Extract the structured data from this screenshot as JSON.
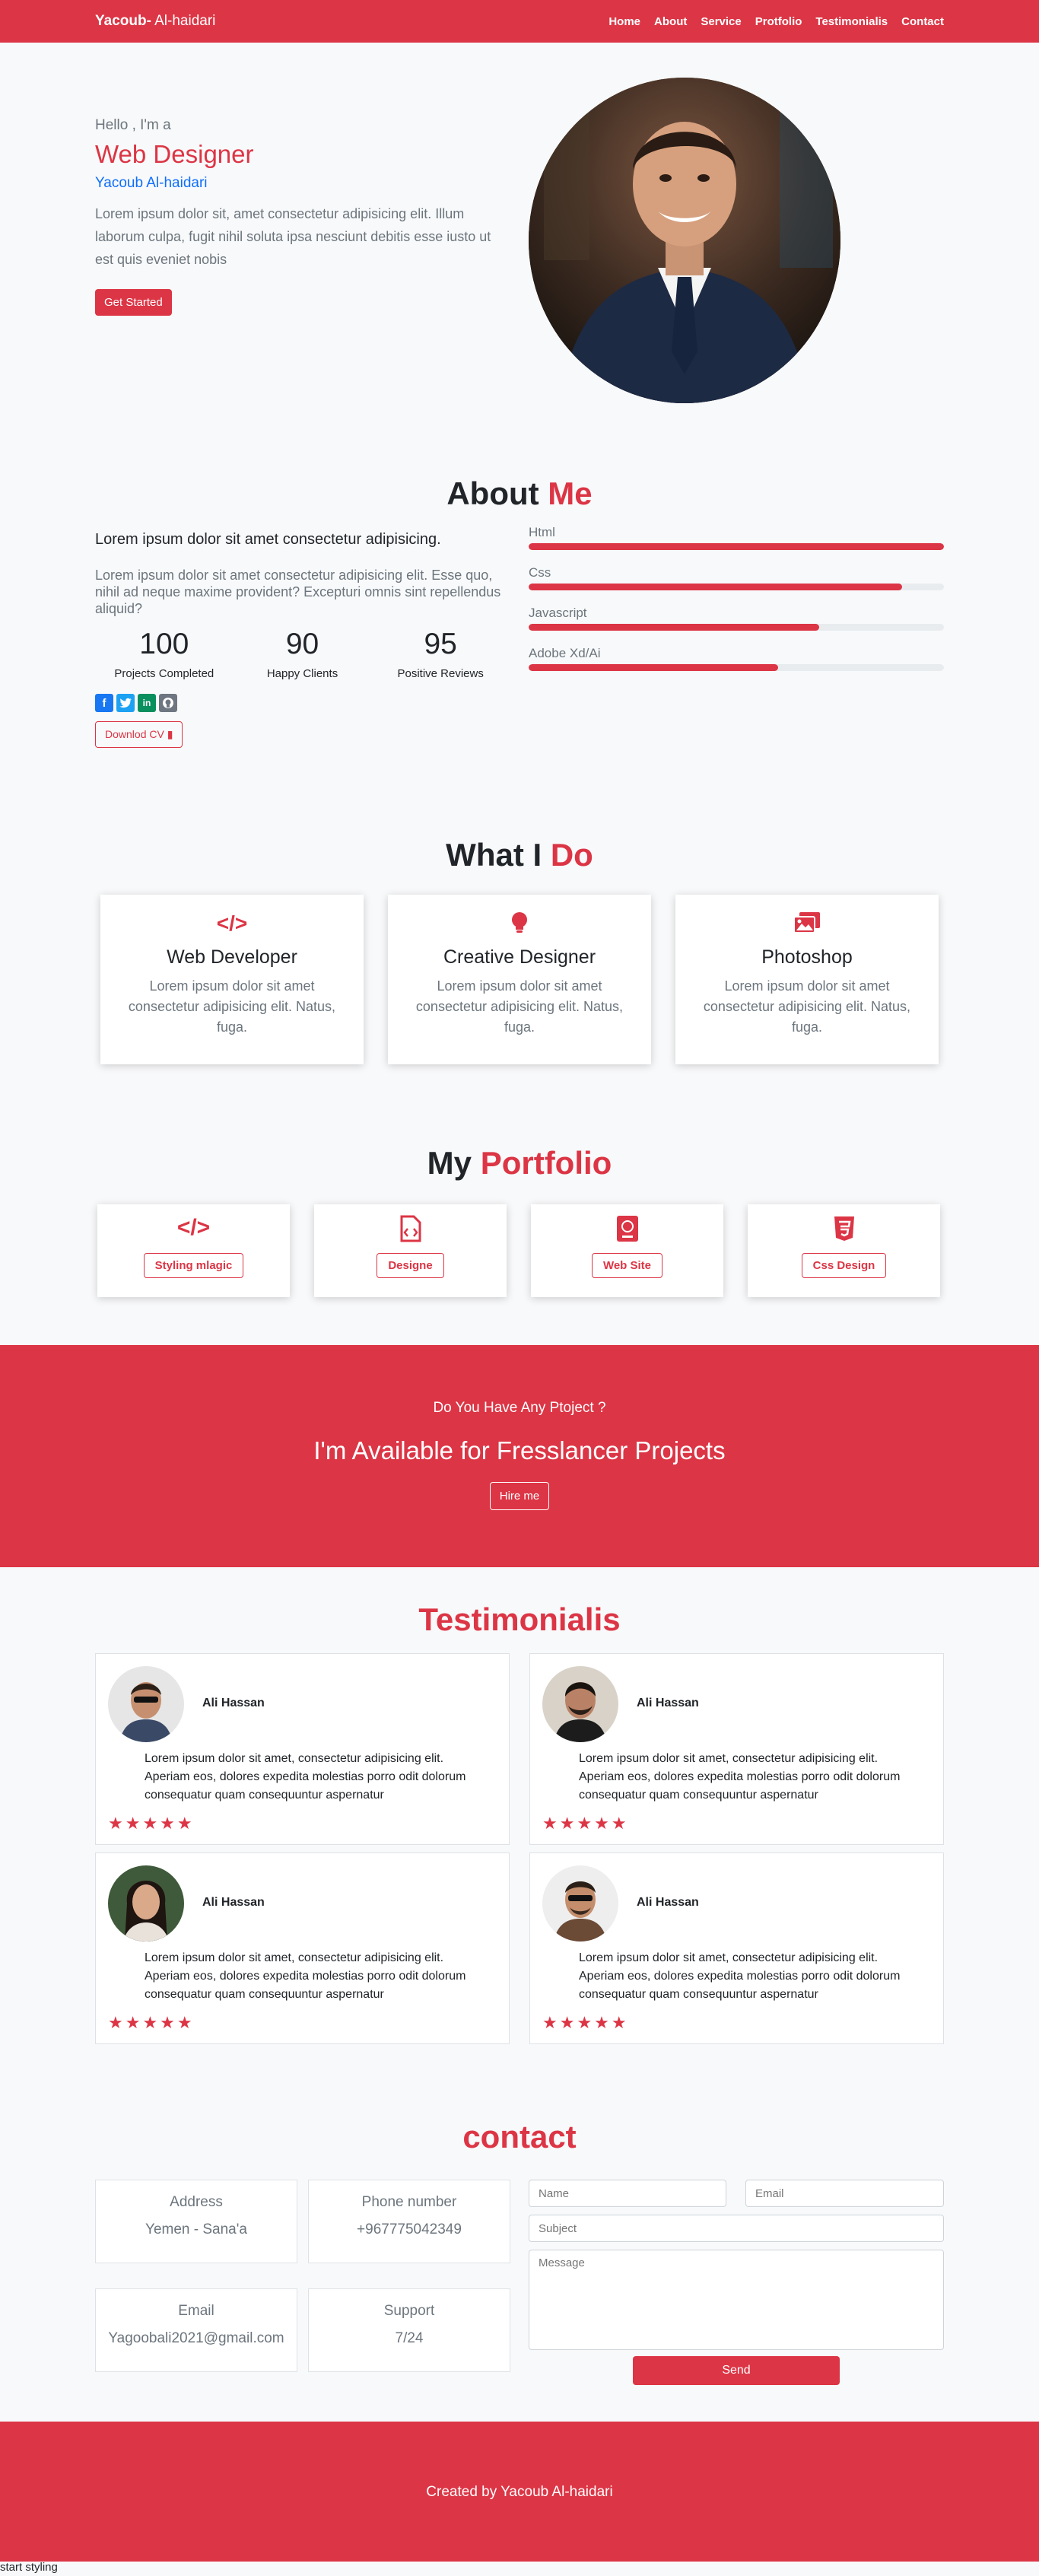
{
  "nav": {
    "brand_bold": "Yacoub-",
    "brand_rest": " Al-haidari",
    "links": [
      "Home",
      "About",
      "Service",
      "Protfolio",
      "Testimonialis",
      "Contact"
    ]
  },
  "hero": {
    "hello": "Hello , I'm a",
    "role": "Web Designer",
    "name": "Yacoub Al-haidari",
    "text": "Lorem ipsum dolor sit, amet consectetur adipisicing elit. Illum laborum culpa, fugit nihil soluta ipsa nesciunt debitis esse iusto ut est quis eveniet nobis",
    "button": "Get Started"
  },
  "about": {
    "title_a": "About ",
    "title_b": "Me",
    "lead": "Lorem ipsum dolor sit amet consectetur adipisicing.",
    "text": "Lorem ipsum dolor sit amet consectetur adipisicing elit. Esse quo, nihil ad neque maxime provident? Excepturi omnis sint repellendus aliquid?",
    "stats": [
      {
        "num": "100",
        "label": "Projects Completed"
      },
      {
        "num": "90",
        "label": "Happy Clients"
      },
      {
        "num": "95",
        "label": "Positive Reviews"
      }
    ],
    "download": "Downlod CV",
    "skills": [
      {
        "label": "Html",
        "level": 1.0
      },
      {
        "label": "Css",
        "level": 0.9
      },
      {
        "label": "Javascript",
        "level": 0.7
      },
      {
        "label": "Adobe Xd/Ai",
        "level": 0.6
      }
    ],
    "colors": {
      "facebook": "#1877f2",
      "twitter": "#1da1f2",
      "linkedin": "#0a8f5f",
      "github": "#6e7681"
    }
  },
  "services": {
    "title_a": "What I ",
    "title_b": "Do",
    "items": [
      {
        "icon": "code-icon",
        "title": "Web Developer",
        "text": "Lorem ipsum dolor sit amet consectetur adipisicing elit. Natus, fuga."
      },
      {
        "icon": "lightbulb-icon",
        "title": "Creative Designer",
        "text": "Lorem ipsum dolor sit amet consectetur adipisicing elit. Natus, fuga."
      },
      {
        "icon": "images-icon",
        "title": "Photoshop",
        "text": "Lorem ipsum dolor sit amet consectetur adipisicing elit. Natus, fuga."
      }
    ]
  },
  "portfolio": {
    "title_a": "My ",
    "title_b": "Portfolio",
    "items": [
      {
        "icon": "code-icon",
        "label": "Styling mlagic"
      },
      {
        "icon": "file-code-icon",
        "label": "Designe"
      },
      {
        "icon": "book-icon",
        "label": "Web Site"
      },
      {
        "icon": "css3-icon",
        "label": "Css Design"
      }
    ]
  },
  "hire": {
    "question": "Do You Have Any Ptoject ?",
    "heading": "I'm Available for Fresslancer Projects",
    "button": "Hire me"
  },
  "testimonials": {
    "title": "Testimonialis",
    "items": [
      {
        "name": "Ali Hassan",
        "text": "Lorem ipsum dolor sit amet, consectetur adipisicing elit. Aperiam eos, dolores expedita molestias porro odit dolorum consequatur quam consequuntur aspernatur",
        "rating": 5
      },
      {
        "name": "Ali Hassan",
        "text": "Lorem ipsum dolor sit amet, consectetur adipisicing elit. Aperiam eos, dolores expedita molestias porro odit dolorum consequatur quam consequuntur aspernatur",
        "rating": 5
      },
      {
        "name": "Ali Hassan",
        "text": "Lorem ipsum dolor sit amet, consectetur adipisicing elit. Aperiam eos, dolores expedita molestias porro odit dolorum consequatur quam consequuntur aspernatur",
        "rating": 5
      },
      {
        "name": "Ali Hassan",
        "text": "Lorem ipsum dolor sit amet, consectetur adipisicing elit. Aperiam eos, dolores expedita molestias porro odit dolorum consequatur quam consequuntur aspernatur",
        "rating": 5
      }
    ]
  },
  "contact": {
    "title": "contact",
    "address_title": "Address",
    "address_value": "Yemen - Sana'a",
    "phone_title": "Phone number",
    "phone_value": "+967775042349",
    "email_title": "Email",
    "email_value": "Yagoobali2021@gmail.com",
    "support_title": "Support",
    "support_value": "7/24",
    "ph_name": "Name",
    "ph_email": "Email",
    "ph_subject": "Subject",
    "ph_message": "Message",
    "send": "Send"
  },
  "footer": {
    "text": "Created by Yacoub Al-haidari"
  },
  "status_text": "start styling"
}
